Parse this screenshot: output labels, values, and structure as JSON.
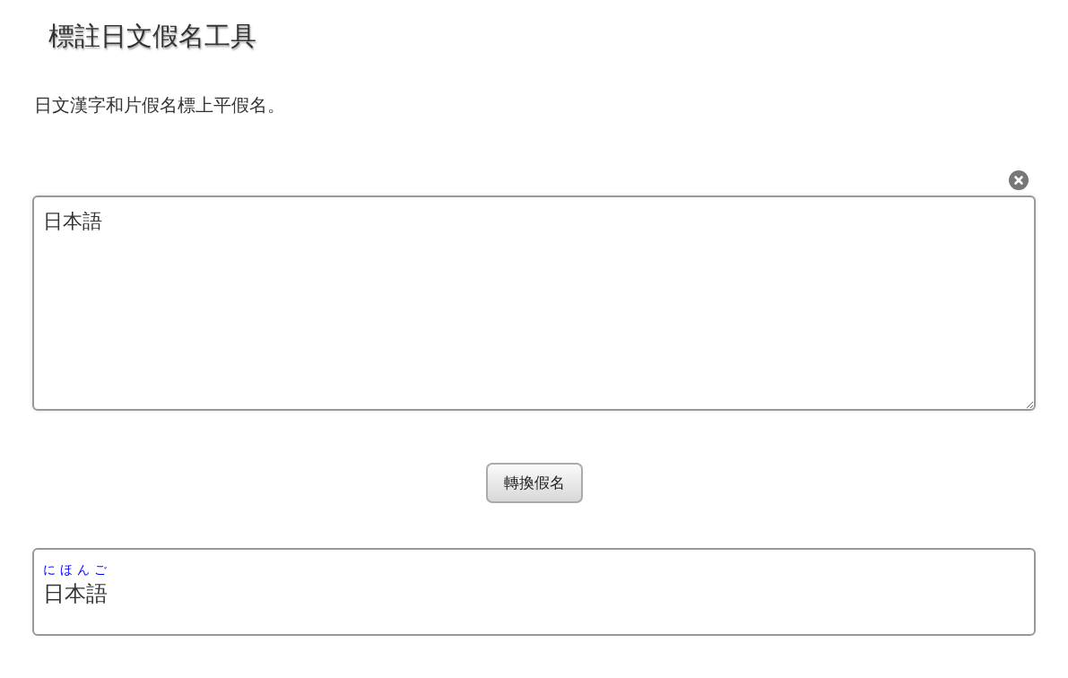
{
  "title": "標註日文假名工具",
  "description": "日文漢字和片假名標上平假名。",
  "input": {
    "value": "日本語"
  },
  "convert_button": "轉換假名",
  "output": {
    "reading": "にほんご",
    "text": "日本語"
  }
}
